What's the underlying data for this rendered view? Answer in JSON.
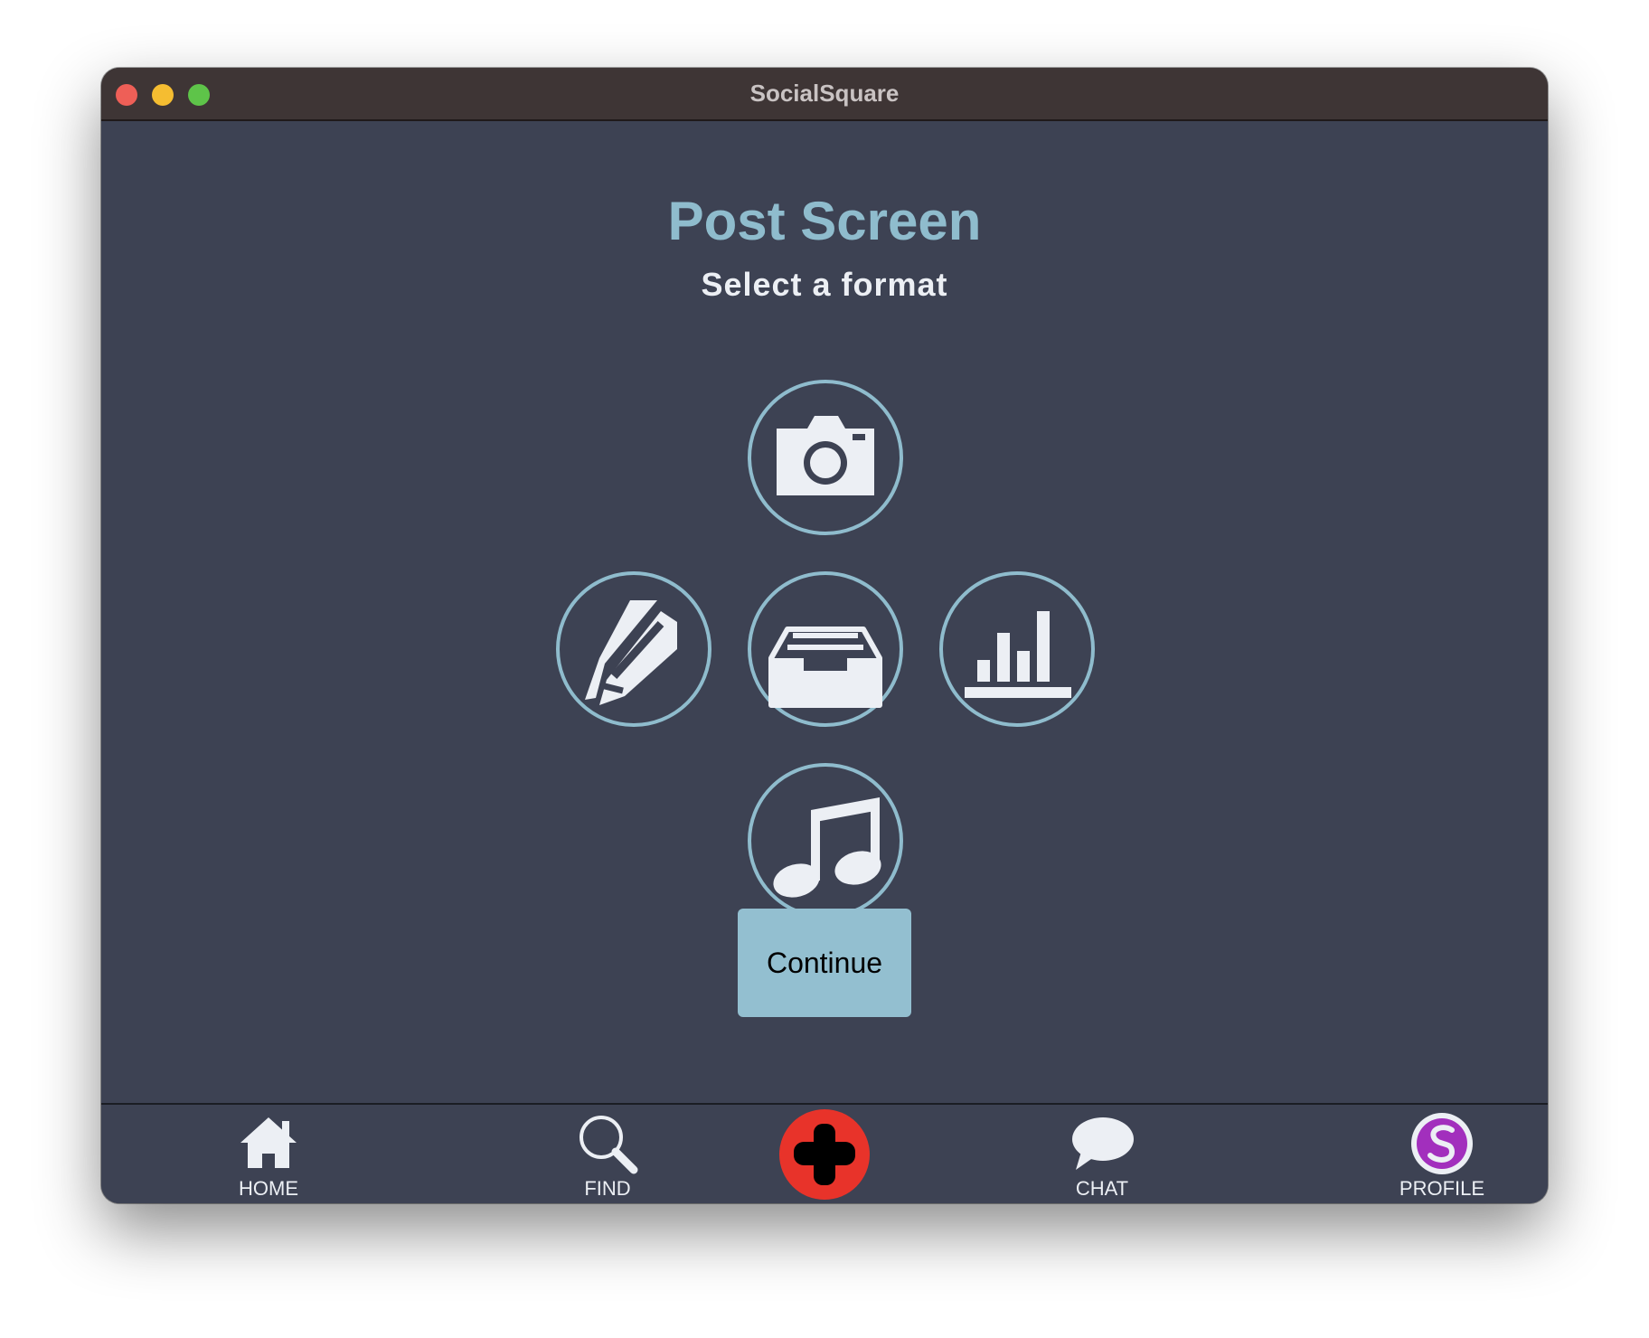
{
  "window": {
    "title": "SocialSquare"
  },
  "main": {
    "title": "Post Screen",
    "subtitle": "Select a format",
    "formats": [
      {
        "name": "photo",
        "icon": "camera-icon"
      },
      {
        "name": "text",
        "icon": "pencil-icon"
      },
      {
        "name": "thread",
        "icon": "tray-icon"
      },
      {
        "name": "poll",
        "icon": "bar-chart-icon"
      },
      {
        "name": "audio",
        "icon": "music-note-icon"
      }
    ],
    "continue_label": "Continue"
  },
  "navbar": {
    "items": [
      {
        "label": "HOME",
        "icon": "home-icon"
      },
      {
        "label": "FIND",
        "icon": "search-icon"
      },
      {
        "label": "",
        "icon": "plus-icon"
      },
      {
        "label": "CHAT",
        "icon": "chat-bubble-icon"
      },
      {
        "label": "PROFILE",
        "icon": "profile-avatar-icon"
      }
    ]
  },
  "colors": {
    "background": "#3d4253",
    "accent": "#8fbccd",
    "titlebar": "#3e3535",
    "create_button": "#e8332a",
    "icon_fill": "#eceff4"
  }
}
